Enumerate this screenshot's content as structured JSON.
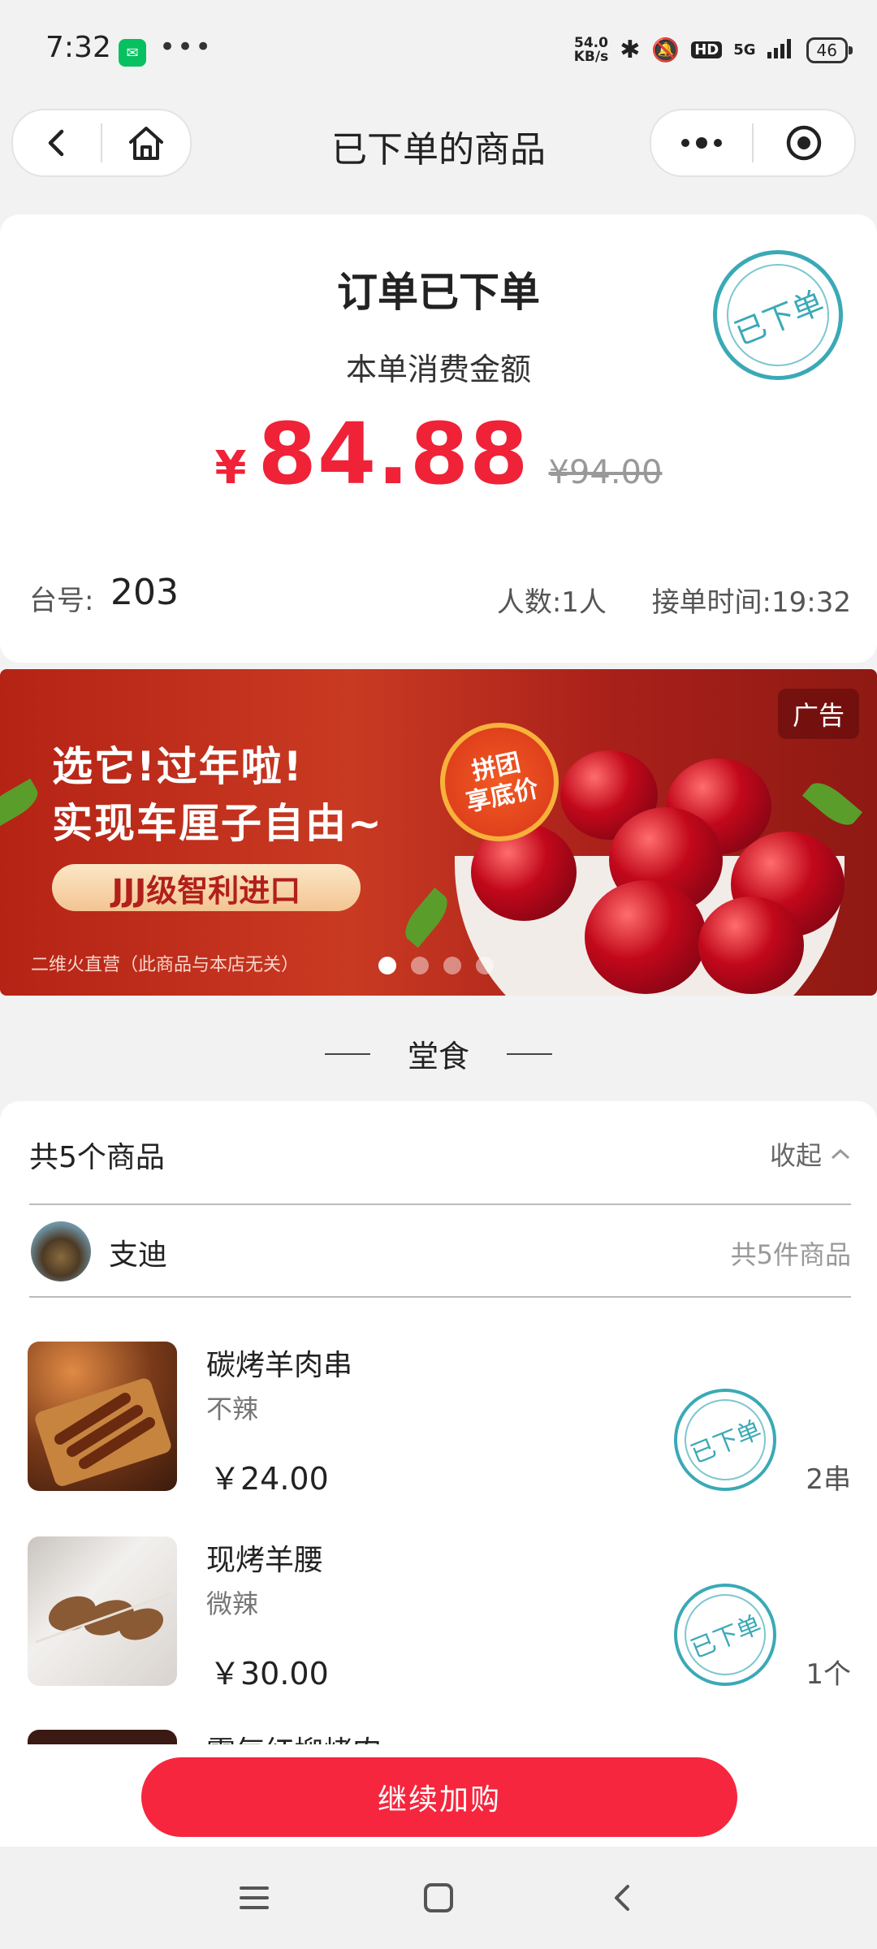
{
  "status_bar": {
    "time": "7:32",
    "net_speed_value": "54.0",
    "net_speed_unit": "KB/s",
    "hd": "HD",
    "network": "5G",
    "battery": "46"
  },
  "nav": {
    "title": "已下单的商品"
  },
  "order": {
    "status_title": "订单已下单",
    "amount_label": "本单消费金额",
    "currency": "¥",
    "amount": "84.88",
    "original_price": "¥94.00",
    "stamp_text": "已下单",
    "table_label": "台号:",
    "table_no": "203",
    "people": "人数:1人",
    "order_time": "接单时间:19:32"
  },
  "banner": {
    "ad_tag": "广告",
    "line1": "选它!过年啦!",
    "line2": "实现车厘子自由~",
    "pill": "JJJ级智利进口",
    "badge_line1": "拼团",
    "badge_line2": "享底价",
    "footnote": "二维火直营（此商品与本店无关）",
    "slides": 4,
    "active_slide": 0
  },
  "section_title": "堂食",
  "items": {
    "count_title": "共5个商品",
    "collapse_label": "收起",
    "user_name": "支迪",
    "user_count": "共5件商品",
    "list": [
      {
        "name": "碳烤羊肉串",
        "spice": "不辣",
        "price": "￥24.00",
        "qty": "2串",
        "stamp": "已下单"
      },
      {
        "name": "现烤羊腰",
        "spice": "微辣",
        "price": "￥30.00",
        "qty": "1个",
        "stamp": "已下单"
      },
      {
        "name": "霸气红柳烤肉"
      }
    ]
  },
  "cta_label": "继续加购",
  "colors": {
    "accent_red": "#f6263e",
    "price_red": "#ef2238",
    "stamp_teal": "#3aa9b6"
  }
}
